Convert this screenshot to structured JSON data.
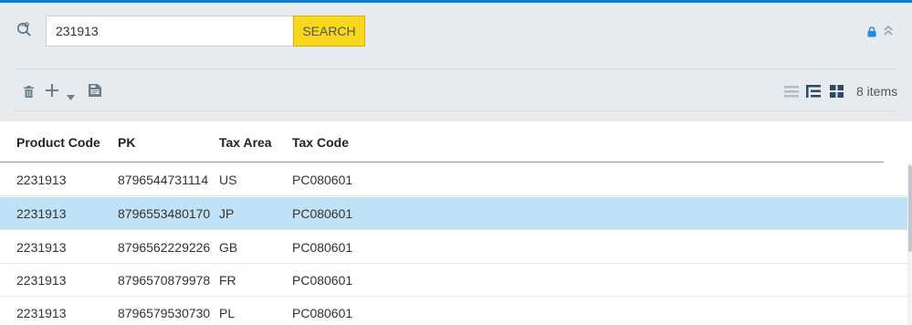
{
  "search": {
    "value": "231913",
    "button_label": "SEARCH"
  },
  "toolbar": {
    "icons": [
      "delete-icon",
      "add-icon",
      "dropdown-icon",
      "export-icon"
    ],
    "view_icons": [
      "list-view-icon",
      "tree-view-icon",
      "grid-view-icon"
    ],
    "items_count": "8 items"
  },
  "colors": {
    "accent": "#0a7fd6",
    "search_button": "#f9d71c",
    "selected_row": "#c0e2f7",
    "panel": "#e6ebef"
  },
  "table": {
    "columns": [
      "Product Code",
      "PK",
      "Tax Area",
      "Tax Code"
    ],
    "rows": [
      [
        "2231913",
        "8796544731114",
        "US",
        "PC080601"
      ],
      [
        "2231913",
        "8796553480170",
        "JP",
        "PC080601"
      ],
      [
        "2231913",
        "8796562229226",
        "GB",
        "PC080601"
      ],
      [
        "2231913",
        "8796570879978",
        "FR",
        "PC080601"
      ],
      [
        "2231913",
        "8796579530730",
        "PL",
        "PC080601"
      ]
    ],
    "selected_row": 1
  }
}
